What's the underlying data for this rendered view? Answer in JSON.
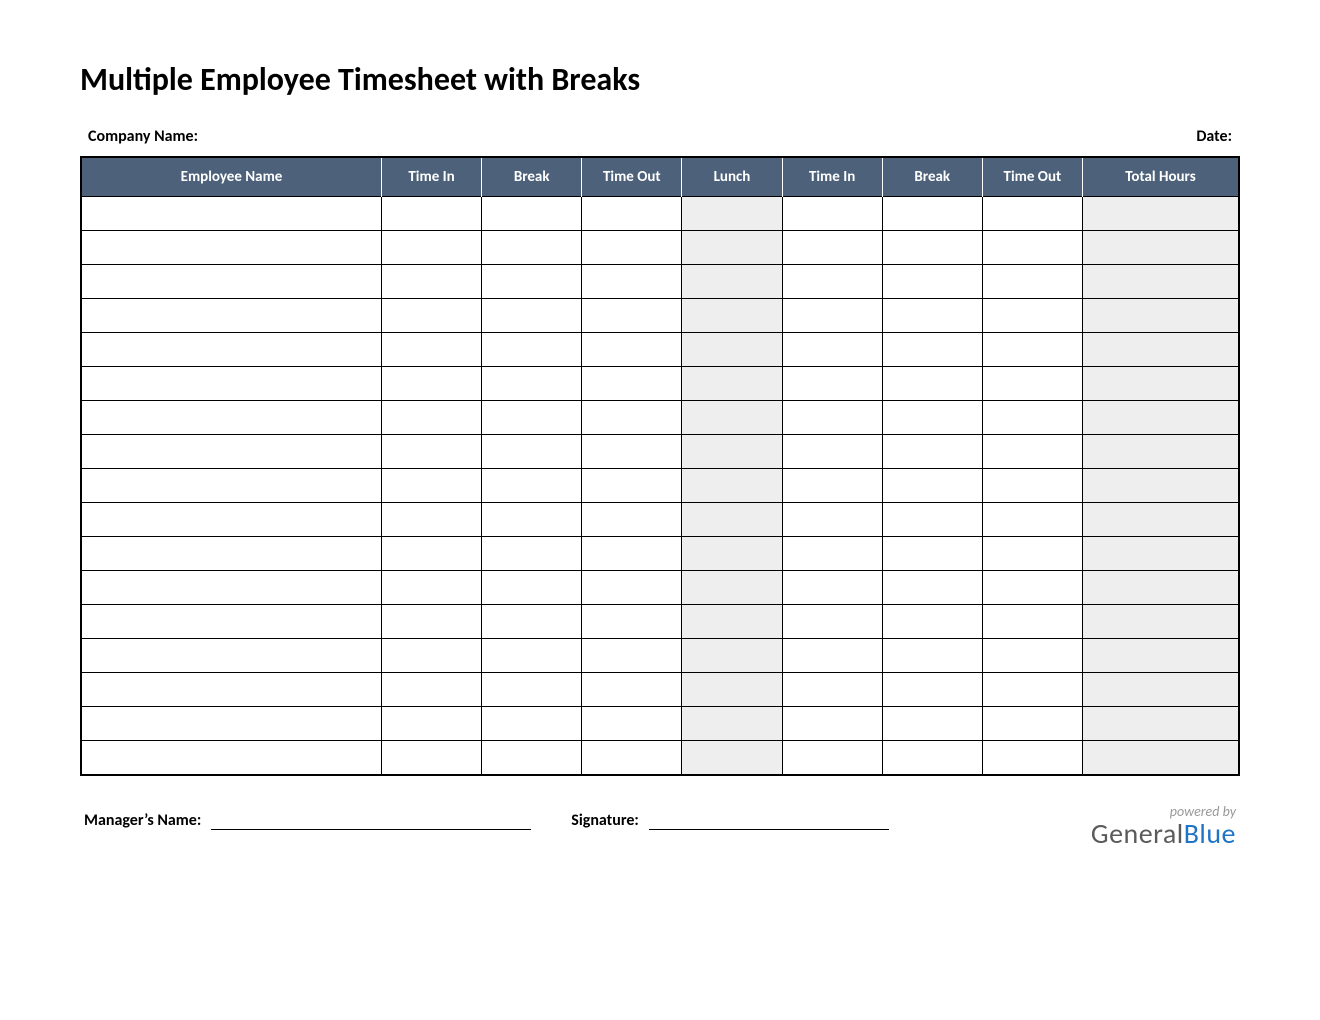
{
  "title": "Multiple Employee Timesheet with Breaks",
  "labels": {
    "company_name": "Company Name:",
    "date": "Date:",
    "managers_name": "Manager’s Name:",
    "signature": "Signature:"
  },
  "columns": [
    "Employee Name",
    "Time In",
    "Break",
    "Time Out",
    "Lunch",
    "Time In",
    "Break",
    "Time Out",
    "Total Hours"
  ],
  "row_count": 17,
  "shaded_column_indices": [
    4,
    8
  ],
  "brand": {
    "powered_by": "powered by",
    "name_part1": "General",
    "name_part2": "Blue"
  },
  "colors": {
    "header_bg": "#4d617a",
    "header_fg": "#ffffff",
    "shaded_cell": "#eeeeee",
    "brand_grey": "#5b5b5b",
    "brand_blue": "#1f74c5"
  }
}
